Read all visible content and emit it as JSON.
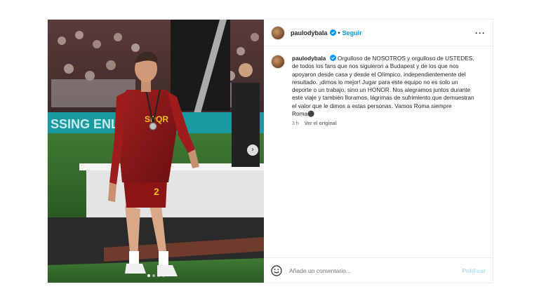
{
  "post": {
    "username": "paulodybala",
    "separator": "•",
    "follow_label": "Seguir",
    "more_icon": "more-horizontal-icon",
    "caption": {
      "username": "paulodybala",
      "text": "Orgulloso de NOSOTROS y orgulloso de USTEDES, de todos los fans que nos siguieron a Budapest y de los que nos apoyaron desde casa y desde el Olímpico, independientemente del resultado. ¡dimos lo mejor! Jugar para este equipo no es solo un deporte o un trabajo, sino un HONOR. Nos alegramos juntos durante este viaje y también lloramos, lágrimas de sufrimiento que demuestran el valor que le dimos a estas personas. Vamos Roma siempre Roma⚫"
    },
    "time_ago": "3 h",
    "see_original": "Ver el original",
    "comment": {
      "placeholder": "Añade un comentario...",
      "publish_label": "Publicar"
    },
    "carousel": {
      "slides": 4,
      "active_index": 0
    },
    "colors": {
      "accent": "#0095f6",
      "publish_disabled": "#b2dffc",
      "jersey": "#8b1a1a"
    }
  }
}
